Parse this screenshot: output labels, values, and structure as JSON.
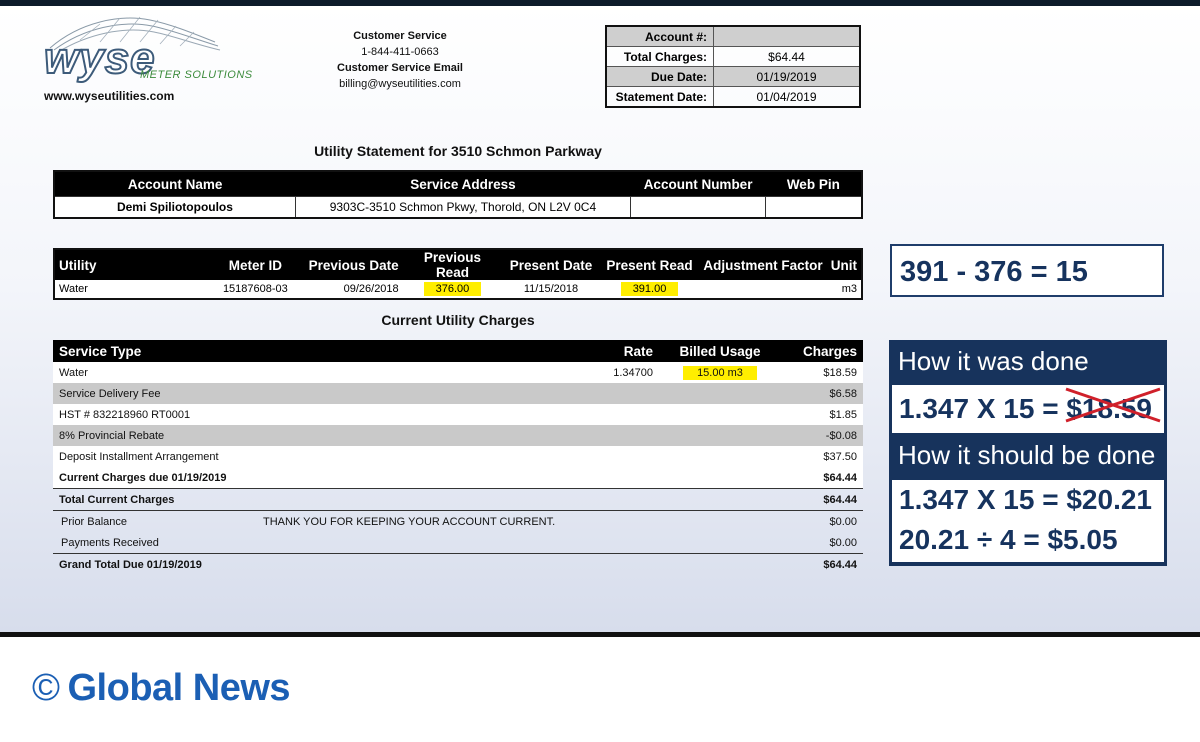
{
  "header": {
    "logo_word": "wyse",
    "logo_sub": "METER SOLUTIONS",
    "website": "www.wyseutilities.com",
    "cs_title": "Customer Service",
    "cs_phone": "1-844-411-0663",
    "cs_email_label": "Customer Service Email",
    "cs_email": "billing@wyseutilities.com"
  },
  "summary": {
    "account_label": "Account #:",
    "account_value": "",
    "total_label": "Total Charges:",
    "total_value": "$64.44",
    "due_label": "Due Date:",
    "due_value": "01/19/2019",
    "statement_label": "Statement Date:",
    "statement_value": "01/04/2019"
  },
  "statement_title": "Utility Statement for 3510 Schmon Parkway",
  "account": {
    "headers": [
      "Account Name",
      "Service Address",
      "Account Number",
      "Web Pin"
    ],
    "name": "Demi Spiliotopoulos",
    "address": "9303C-3510 Schmon Pkwy, Thorold, ON L2V 0C4",
    "number": "",
    "pin": ""
  },
  "utility": {
    "headers": [
      "Utility",
      "Meter ID",
      "Previous Date",
      "Previous Read",
      "Present Date",
      "Present Read",
      "Adjustment Factor",
      "Unit"
    ],
    "row": {
      "utility": "Water",
      "meter": "15187608-03",
      "prev_date": "09/26/2018",
      "prev_read": "376.00",
      "pres_date": "11/15/2018",
      "pres_read": "391.00",
      "adj": "",
      "unit": "m3"
    }
  },
  "charges_title": "Current Utility Charges",
  "charges": {
    "headers": [
      "Service Type",
      "Rate",
      "Billed Usage",
      "Charges"
    ],
    "water": {
      "label": "Water",
      "rate": "1.34700",
      "usage": "15.00 m3",
      "amount": "$18.59"
    },
    "delivery": {
      "label": "Service Delivery Fee",
      "amount": "$6.58"
    },
    "hst": {
      "label": "HST # 832218960 RT0001",
      "amount": "$1.85"
    },
    "rebate": {
      "label": "8% Provincial Rebate",
      "amount": "-$0.08"
    },
    "deposit": {
      "label": "Deposit Installment Arrangement",
      "amount": "$37.50"
    },
    "current_due": {
      "label": "Current Charges due 01/19/2019",
      "amount": "$64.44"
    },
    "total_current": {
      "label": "Total Current Charges",
      "amount": "$64.44"
    },
    "prior": {
      "label": "Prior Balance",
      "note": "THANK YOU FOR KEEPING YOUR ACCOUNT CURRENT.",
      "amount": "$0.00"
    },
    "payments": {
      "label": "Payments Received",
      "amount": "$0.00"
    },
    "grand": {
      "label": "Grand Total Due 01/19/2019",
      "amount": "$64.44"
    }
  },
  "annotations": {
    "equation": "391 - 376 = 15",
    "was_heading": "How it was done",
    "was_lhs": "1.347 X 15 = ",
    "was_value": "$18.59",
    "should_heading": "How it should be done",
    "should_line1": "1.347 X 15 = $20.21",
    "should_line2": "20.21 ÷ 4 = $5.05",
    "strike_color": "#d0202a"
  },
  "footer": {
    "copyright_symbol": "©",
    "credit": "Global News"
  }
}
